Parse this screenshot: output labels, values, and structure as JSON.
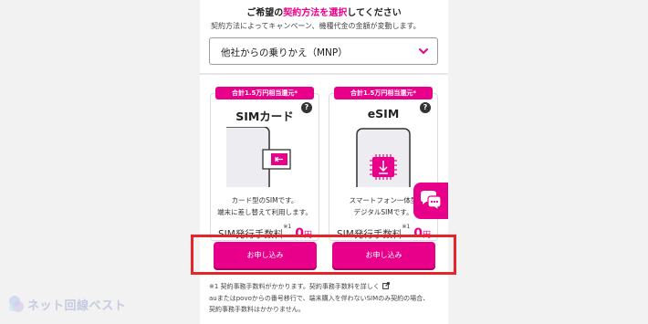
{
  "heading": {
    "prefix": "ご希望の",
    "accent": "契約方法を選択",
    "suffix": "してください"
  },
  "subtext": "契約方法によってキャンペーン、機種代金の金額が変動します。",
  "contract_select": {
    "selected_value": "他社からの乗りかえ（MNP）",
    "icon": "chevron-down-icon"
  },
  "cards": [
    {
      "badge": "合計1.5万円相当還元*",
      "title": "SIMカード",
      "help": "?",
      "desc_line1": "カード型のSIMです。",
      "desc_line2": "端末に差し替えて利用します。",
      "fee_label": "SIM発行手数料",
      "fee_sup": "※1",
      "fee_value": "0",
      "fee_unit": "円",
      "button": "お申し込み",
      "icon": "sim-card-icon"
    },
    {
      "badge": "合計1.5万円相当還元*",
      "title": "eSIM",
      "help": "?",
      "desc_line1": "スマートフォン一体型",
      "desc_line2": "デジタルSIMです。",
      "fee_label": "SIM発行手数料",
      "fee_sup": "※1",
      "fee_value": "0",
      "fee_unit": "円",
      "button": "お申し込み",
      "icon": "esim-phone-icon"
    }
  ],
  "notes": {
    "line1": "※1 契約事務手数料がかかります。契約事務手数料を詳しく",
    "line2": "auまたはpovoからの番号移行で、端末購入を伴わないSIMのみ契約の場合、",
    "line3": "契約事務手数料はかかりません。"
  },
  "watermark": "ネット回線ベスト",
  "colors": {
    "accent": "#e8008b",
    "highlight": "#e8242b"
  }
}
